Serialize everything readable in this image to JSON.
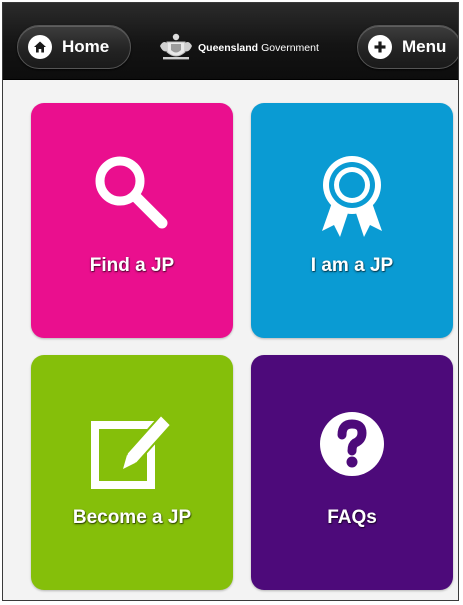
{
  "header": {
    "home_label": "Home",
    "menu_label": "Menu",
    "brand_bold": "Queensland",
    "brand_regular": "Government",
    "bar_color": "#141414"
  },
  "tiles": [
    {
      "label": "Find a JP",
      "icon": "search-icon",
      "color": "#ea0f8e"
    },
    {
      "label": "I am a JP",
      "icon": "award-ribbon-icon",
      "color": "#0a9bd3"
    },
    {
      "label": "Become a JP",
      "icon": "edit-pencil-icon",
      "color": "#85bf0a"
    },
    {
      "label": "FAQs",
      "icon": "question-mark-icon",
      "color": "#4d0a7a"
    }
  ]
}
